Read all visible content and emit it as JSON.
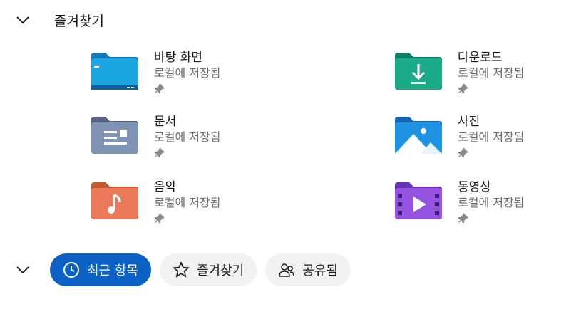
{
  "favorites_header": {
    "title": "즐겨찾기"
  },
  "items": [
    {
      "name": "바탕 화면",
      "status": "로컬에 저장됨",
      "icon": "desktop-folder-icon"
    },
    {
      "name": "다운로드",
      "status": "로컬에 저장됨",
      "icon": "downloads-folder-icon"
    },
    {
      "name": "문서",
      "status": "로컬에 저장됨",
      "icon": "documents-folder-icon"
    },
    {
      "name": "사진",
      "status": "로컬에 저장됨",
      "icon": "pictures-folder-icon"
    },
    {
      "name": "음악",
      "status": "로컬에 저장됨",
      "icon": "music-folder-icon"
    },
    {
      "name": "동영상",
      "status": "로컬에 저장됨",
      "icon": "videos-folder-icon"
    }
  ],
  "tabs": [
    {
      "label": "최근 항목",
      "icon": "clock-icon",
      "active": true
    },
    {
      "label": "즐겨찾기",
      "icon": "star-icon",
      "active": false
    },
    {
      "label": "공유됨",
      "icon": "people-icon",
      "active": false
    }
  ],
  "colors": {
    "accent": "#0b62c4",
    "desktop": "#1aa0d8",
    "downloads": "#1ba786",
    "documents": "#6a7d9c",
    "pictures": "#1f8fde",
    "music": "#e8734f",
    "videos": "#8a4fd8"
  }
}
